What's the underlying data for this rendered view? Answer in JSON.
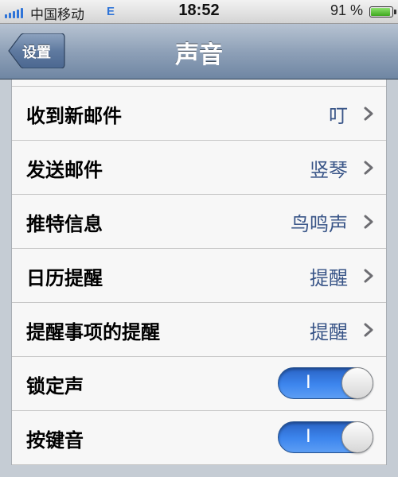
{
  "status_bar": {
    "carrier": "中国移动",
    "network": "E",
    "time": "18:52",
    "battery_percent": "91 %",
    "battery_level": 0.91,
    "signal_bars": 5
  },
  "nav": {
    "back_label": "设置",
    "title": "声音"
  },
  "rows": [
    {
      "label": "收到新邮件",
      "value": "叮",
      "type": "disclosure"
    },
    {
      "label": "发送邮件",
      "value": "竖琴",
      "type": "disclosure"
    },
    {
      "label": "推特信息",
      "value": "鸟鸣声",
      "type": "disclosure"
    },
    {
      "label": "日历提醒",
      "value": "提醒",
      "type": "disclosure"
    },
    {
      "label": "提醒事项的提醒",
      "value": "提醒",
      "type": "disclosure"
    },
    {
      "label": "锁定声",
      "toggle_label": "I",
      "on": true,
      "type": "switch"
    },
    {
      "label": "按键音",
      "toggle_label": "I",
      "on": true,
      "type": "switch"
    }
  ],
  "colors": {
    "value_text": "#385487",
    "switch_on": "#3d86ee",
    "nav_bar": "#8fa1b8"
  }
}
